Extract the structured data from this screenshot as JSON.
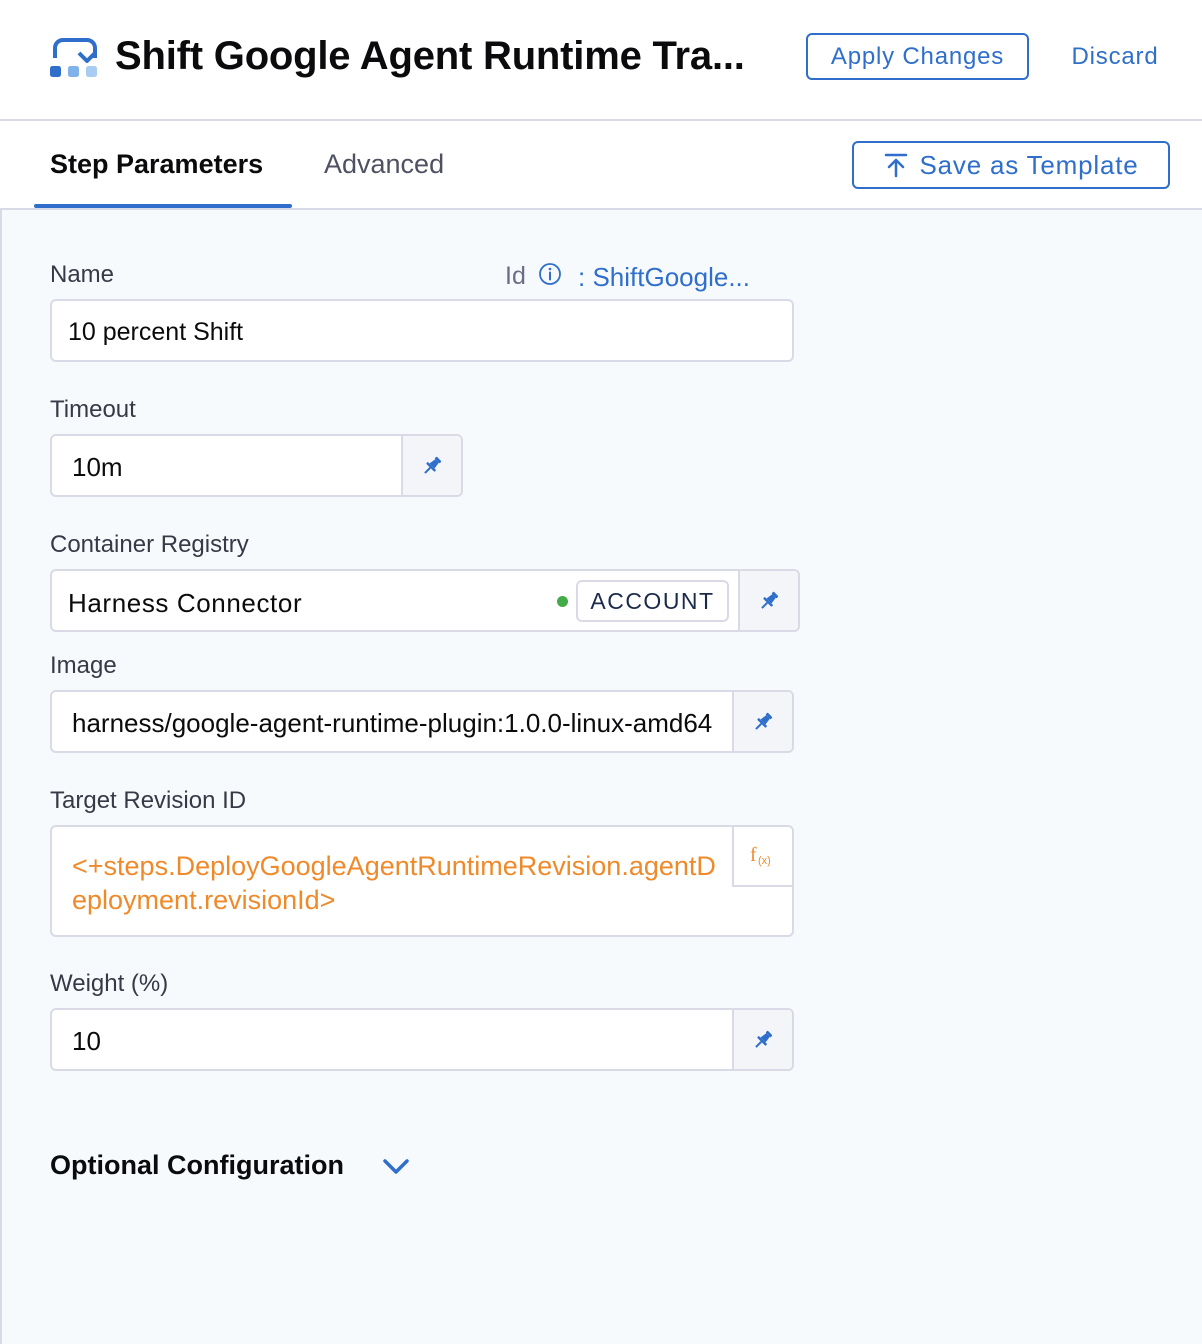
{
  "header": {
    "title": "Shift Google Agent Runtime Tra...",
    "step_icon": "step-transition-icon",
    "apply_label": "Apply Changes",
    "discard_label": "Discard"
  },
  "tabs": [
    {
      "label": "Step Parameters",
      "active": true
    },
    {
      "label": "Advanced",
      "active": false
    }
  ],
  "save_template": {
    "label": "Save as Template",
    "icon": "upload-icon"
  },
  "form": {
    "name": {
      "label": "Name",
      "value": "10 percent Shift"
    },
    "id": {
      "label": "Id",
      "value": ": ShiftGoogle..."
    },
    "timeout": {
      "label": "Timeout",
      "value": "10m"
    },
    "container_registry": {
      "label": "Container Registry",
      "value": "Harness Connector",
      "scope": "ACCOUNT",
      "status": "connected"
    },
    "image": {
      "label": "Image",
      "value": "harness/google-agent-runtime-plugin:1.0.0-linux-amd64"
    },
    "target_revision": {
      "label": "Target Revision ID",
      "value": "<+steps.DeployGoogleAgentRuntimeRevision.agentDeployment.revisionId>"
    },
    "weight": {
      "label": "Weight (%)",
      "value": "10"
    }
  },
  "optional": {
    "label": "Optional Configuration"
  },
  "colors": {
    "accent": "#2f6fcb",
    "expression": "#ef8a2b",
    "status_green": "#42ab45"
  }
}
